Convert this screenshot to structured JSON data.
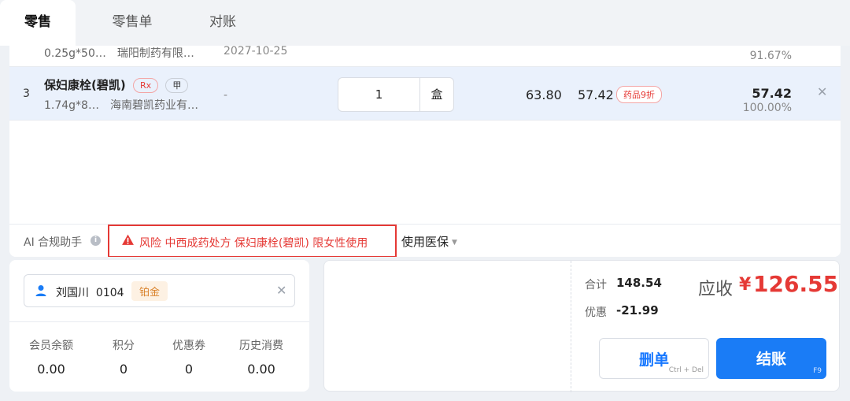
{
  "tabs": [
    {
      "label": "零售",
      "active": true
    },
    {
      "label": "零售单",
      "active": false
    },
    {
      "label": "对账",
      "active": false
    }
  ],
  "rows": [
    {
      "spec": "0.25g*50…",
      "manufacturer": "瑞阳制药有限…",
      "expiry": "2027-10-25",
      "percent": "91.67%"
    },
    {
      "index": "3",
      "name": "保妇康栓(碧凯)",
      "tags": [
        "Rx",
        "甲"
      ],
      "spec": "1.74g*8…",
      "manufacturer": "海南碧凯药业有…",
      "expiry": "-",
      "quantity": "1",
      "unit": "盒",
      "price": "63.80",
      "sale_price": "57.42",
      "discount_tag": "药品9折",
      "subtotal": "57.42",
      "percent": "100.00%",
      "remove_icon": "close-icon"
    }
  ],
  "ai": {
    "label": "AI 合规助手",
    "info_icon": "info-icon",
    "warning_icon": "warning-triangle-icon",
    "risk_text": "风险  中西成药处方 保妇康栓(碧凯) 限女性使用",
    "insurance_label": "使用医保"
  },
  "member": {
    "icon": "user-icon",
    "name": "刘国川",
    "code": "0104",
    "level": "铂金",
    "stats": [
      {
        "label": "会员余额",
        "value": "0.00"
      },
      {
        "label": "积分",
        "value": "0"
      },
      {
        "label": "优惠券",
        "value": "0"
      },
      {
        "label": "历史消费",
        "value": "0.00"
      }
    ]
  },
  "payment": {
    "total_label": "合计",
    "total_value": "148.54",
    "discount_label": "优惠",
    "discount_value": "-21.99",
    "due_label": "应收",
    "currency": "¥",
    "due_value": "126.55",
    "delete_label": "删单",
    "delete_shortcut": "Ctrl + Del",
    "checkout_label": "结账",
    "checkout_shortcut": "F9"
  },
  "colors": {
    "accent": "#1a7cf6",
    "danger": "#e53935",
    "selected_row": "#eaf1fc",
    "badge_gold": "#d9822b"
  }
}
